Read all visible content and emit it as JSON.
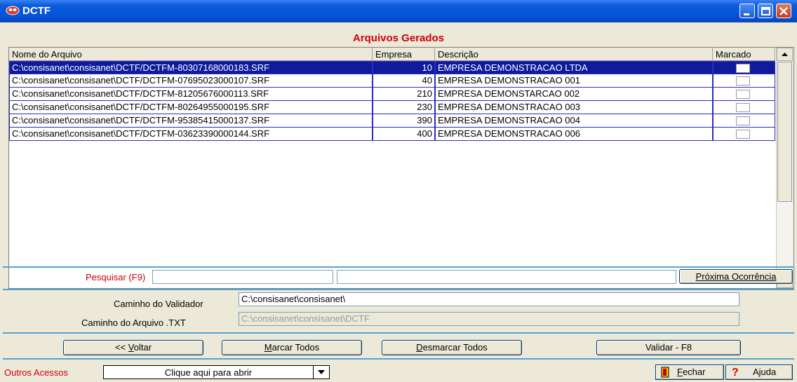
{
  "window": {
    "title": "DCTF"
  },
  "heading": "Arquivos Gerados",
  "table": {
    "columns": [
      "Nome do Arquivo",
      "Empresa",
      "Descrição",
      "Marcado"
    ],
    "rows": [
      {
        "file": "C:\\consisanet\\consisanet\\DCTF/DCTFM-80307168000183.SRF",
        "empresa": "10",
        "descricao": "EMPRESA DEMONSTRACAO LTDA",
        "marcado": false
      },
      {
        "file": "C:\\consisanet\\consisanet\\DCTF/DCTFM-07695023000107.SRF",
        "empresa": "40",
        "descricao": "EMPRESA DEMONSTRACAO 001",
        "marcado": false
      },
      {
        "file": "C:\\consisanet\\consisanet\\DCTF/DCTFM-81205676000113.SRF",
        "empresa": "210",
        "descricao": "EMPRESA DEMONSTARCAO 002",
        "marcado": false
      },
      {
        "file": "C:\\consisanet\\consisanet\\DCTF/DCTFM-80264955000195.SRF",
        "empresa": "230",
        "descricao": "EMPRESA DEMONSTRACAO 003",
        "marcado": false
      },
      {
        "file": "C:\\consisanet\\consisanet\\DCTF/DCTFM-95385415000137.SRF",
        "empresa": "390",
        "descricao": "EMPRESA DEMONSTRACAO 004",
        "marcado": false
      },
      {
        "file": "C:\\consisanet\\consisanet\\DCTF/DCTFM-03623390000144.SRF",
        "empresa": "400",
        "descricao": "EMPRESA DEMONSTRACAO 006",
        "marcado": false
      }
    ],
    "selected_row": 0
  },
  "search": {
    "label": "Pesquisar (F9)",
    "value": "",
    "value2": "",
    "next_button": "Próxima Ocorrência"
  },
  "paths": {
    "validador_label": "Caminho do Validador",
    "validador_value": "C:\\consisanet\\consisanet\\",
    "arquivo_label": "Caminho do  Arquivo .TXT",
    "arquivo_value": "C:\\consisanet\\consisanet\\DCTF"
  },
  "buttons": {
    "voltar_prefix": "<< ",
    "voltar_key": "V",
    "voltar_rest": "oltar",
    "marcar_key": "M",
    "marcar_rest": "arcar Todos",
    "desmarcar_key": "D",
    "desmarcar_rest": "esmarcar Todos",
    "validar": "Validar  - F8"
  },
  "footer": {
    "outros_label": "Outros Acessos",
    "combo_value": "Clique aqui para abrir",
    "fechar_key": "F",
    "fechar_rest": "echar",
    "ajuda": "Ajuda"
  },
  "colors": {
    "accent_red": "#d0000a",
    "selection": "#0f1a9c",
    "separator": "#56a2cf",
    "titlebar": "#0453d8"
  },
  "icons": [
    "app-icon",
    "minimize-icon",
    "maximize-icon",
    "close-icon",
    "scroll-up-icon",
    "scroll-down-icon",
    "dropdown-arrow-icon",
    "exit-door-icon",
    "help-icon"
  ]
}
